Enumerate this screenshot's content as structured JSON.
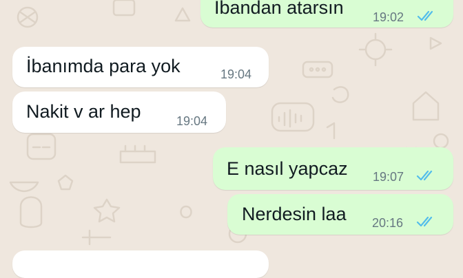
{
  "colors": {
    "wallpaper": "#efe7de",
    "incoming_bubble": "#ffffff",
    "outgoing_bubble": "#d9fdd3",
    "read_ticks": "#53bdeb",
    "time_text": "#667781"
  },
  "messages": [
    {
      "direction": "outgoing",
      "text": "İbandan atarsın",
      "time": "19:02",
      "status": "read",
      "status_icon": "double-check-icon"
    },
    {
      "direction": "incoming",
      "text": "İbanımda para yok",
      "time": "19:04"
    },
    {
      "direction": "incoming",
      "text": "Nakit v ar hep",
      "time": "19:04"
    },
    {
      "direction": "outgoing",
      "text": "E nasıl yapcaz",
      "time": "19:07",
      "status": "read",
      "status_icon": "double-check-icon"
    },
    {
      "direction": "outgoing",
      "text": "Nerdesin laa",
      "time": "20:16",
      "status": "read",
      "status_icon": "double-check-icon"
    }
  ]
}
